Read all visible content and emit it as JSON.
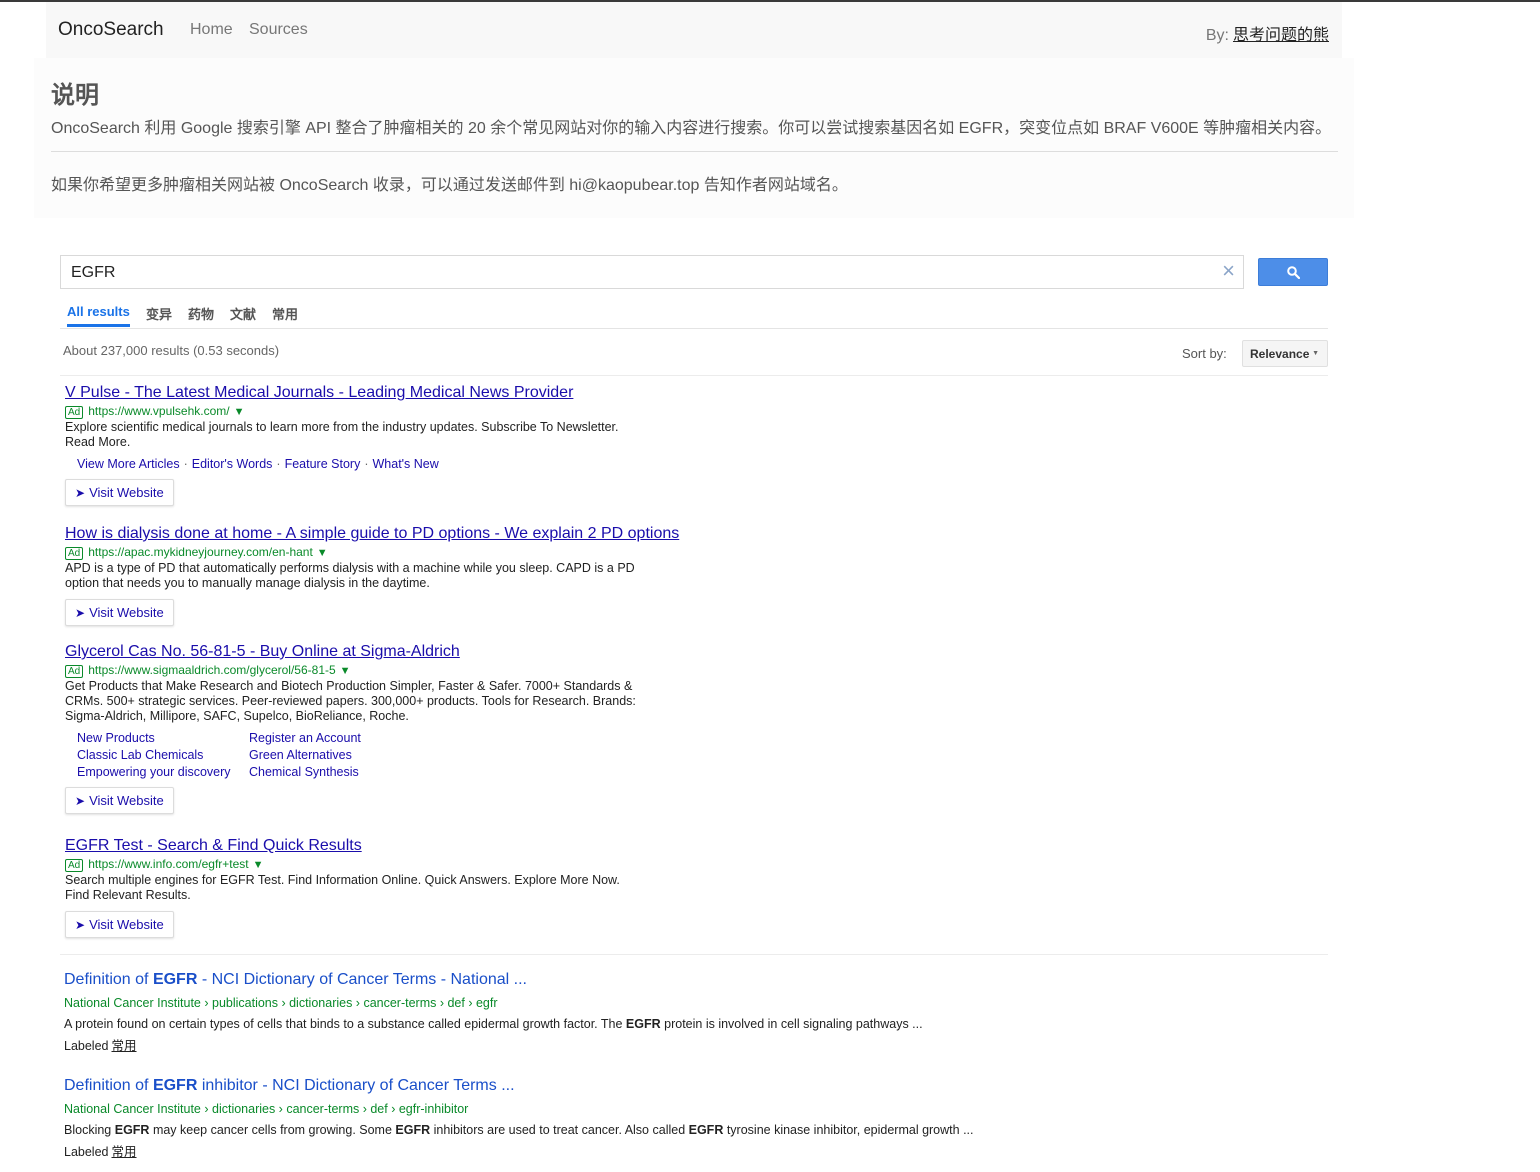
{
  "navbar": {
    "brand": "OncoSearch",
    "links": [
      "Home",
      "Sources"
    ],
    "author_prefix": "By:",
    "author_name": "思考问题的熊"
  },
  "intro": {
    "title": "说明",
    "paragraph1": "OncoSearch 利用 Google 搜索引擎 API 整合了肿瘤相关的 20 余个常见网站对你的输入内容进行搜索。你可以尝试搜索基因名如 EGFR，突变位点如 BRAF V600E 等肿瘤相关内容。",
    "paragraph2": "如果你希望更多肿瘤相关网站被 OncoSearch 收录，可以通过发送邮件到 hi@kaopubear.top 告知作者网站域名。"
  },
  "search": {
    "query": "EGFR",
    "clear_icon": "close-icon",
    "button_icon": "search-icon",
    "button_color": "#4d8ee8"
  },
  "tabs": [
    "All results",
    "变异",
    "药物",
    "文献",
    "常用"
  ],
  "results_info": "About 237,000 results (0.53 seconds)",
  "sort": {
    "label": "Sort by:",
    "value": "Relevance"
  },
  "ads": [
    {
      "title": "V Pulse - The Latest Medical Journals - Leading Medical News Provider",
      "badge": "Ad",
      "url": "https://www.vpulsehk.com/",
      "desc": [
        "Explore scientific medical journals to learn more from the industry updates. Subscribe To Newsletter.",
        "Read More."
      ],
      "sitelinks": [
        "View More Articles",
        "Editor's Words",
        "Feature Story",
        "What's New"
      ],
      "visit": "Visit Website"
    },
    {
      "title": "How is dialysis done at home - A simple guide to PD options - We explain 2 PD options",
      "badge": "Ad",
      "url": "https://apac.mykidneyjourney.com/en-hant",
      "desc": [
        "APD is a type of PD that automatically performs dialysis with a machine while you sleep. CAPD is a PD",
        "option that needs you to manually manage dialysis in the daytime."
      ],
      "visit": "Visit Website"
    },
    {
      "title": "Glycerol Cas No. 56-81-5 - Buy Online at Sigma-Aldrich",
      "badge": "Ad",
      "url": "https://www.sigmaaldrich.com/glycerol/56-81-5",
      "desc": [
        "Get Products that Make Research and Biotech Production Simpler, Faster & Safer. 7000+ Standards &",
        "CRMs. 500+ strategic services. Peer-reviewed papers. 300,000+ products. Tools for Research. Brands:",
        "Sigma-Aldrich, Millipore, SAFC, Supelco, BioReliance, Roche."
      ],
      "sitelinks": [
        "New Products",
        "Register an Account",
        "Classic Lab Chemicals",
        "Green Alternatives",
        "Empowering your discovery",
        "Chemical Synthesis"
      ],
      "visit": "Visit Website"
    },
    {
      "title": "EGFR Test - Search & Find Quick Results",
      "badge": "Ad",
      "url": "https://www.info.com/egfr+test",
      "desc": [
        "Search multiple engines for EGFR Test. Find Information Online. Quick Answers. Explore More Now.",
        "Find Relevant Results."
      ],
      "visit": "Visit Website"
    }
  ],
  "results": [
    {
      "title_pre": "Definition of ",
      "title_bold": "EGFR",
      "title_post": " - NCI Dictionary of Cancer Terms - National ...",
      "url": "National Cancer Institute › publications › dictionaries › cancer-terms › def › egfr",
      "snippet_pre": "A protein found on certain types of cells that binds to a substance called epidermal growth factor. The ",
      "snippet_bold": "EGFR",
      "snippet_post": " protein is involved in cell signaling pathways ...",
      "label_prefix": "Labeled",
      "label": "常用"
    },
    {
      "title_pre": "Definition of ",
      "title_bold": "EGFR",
      "title_post": " inhibitor - NCI Dictionary of Cancer Terms ...",
      "url": "National Cancer Institute › dictionaries › cancer-terms › def › egfr-inhibitor",
      "snippet_parts": [
        "Blocking ",
        "EGFR",
        " may keep cancer cells from growing. Some ",
        "EGFR",
        " inhibitors are used to treat cancer. Also called ",
        "EGFR",
        " tyrosine kinase inhibitor, epidermal growth ..."
      ],
      "label_prefix": "Labeled",
      "label": "常用"
    }
  ],
  "colors": {
    "link": "#1a0dab",
    "organic_link": "#1a4fc9",
    "url_green": "#0a8a2a",
    "tab_active": "#1a73e8"
  }
}
